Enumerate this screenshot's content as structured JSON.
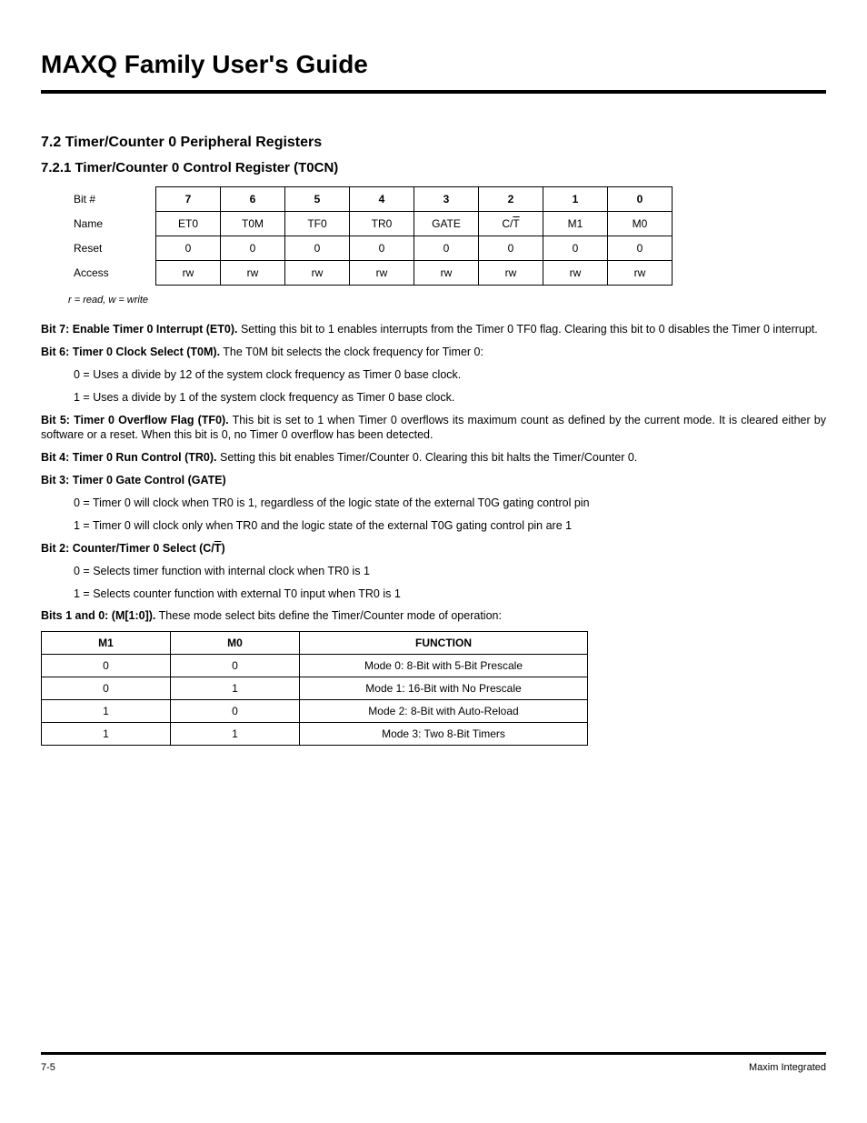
{
  "doc_title": "MAXQ Family User's Guide",
  "section": "7.2 Timer/Counter 0 Peripheral Registers",
  "subsection": "7.2.1 Timer/Counter 0 Control Register (T0CN)",
  "register_table": {
    "row_labels": [
      "Bit #",
      "Name",
      "Reset",
      "Access"
    ],
    "bit_nums": [
      "7",
      "6",
      "5",
      "4",
      "3",
      "2",
      "1",
      "0"
    ],
    "names": [
      "ET0",
      "T0M",
      "TF0",
      "TR0",
      "GATE",
      "C/",
      "M1",
      "M0"
    ],
    "t_overline": "T",
    "resets": [
      "0",
      "0",
      "0",
      "0",
      "0",
      "0",
      "0",
      "0"
    ],
    "access": [
      "rw",
      "rw",
      "rw",
      "rw",
      "rw",
      "rw",
      "rw",
      "rw"
    ]
  },
  "note": "r = read, w = write",
  "bit7": {
    "label": "Bit 7: Enable Timer 0 Interrupt (ET0).",
    "text": " Setting this bit to 1 enables interrupts from the Timer 0 TF0 flag. Clearing this bit to 0 disables the Timer 0 interrupt."
  },
  "bit6": {
    "label": "Bit 6: Timer 0 Clock Select (T0M).",
    "text": " The T0M bit selects the clock frequency for Timer 0:",
    "opt0": "0 = Uses a divide by 12 of the system clock frequency as Timer 0 base clock.",
    "opt1": "1 = Uses a divide by 1 of the system clock frequency as Timer 0 base clock."
  },
  "bit5": {
    "label": "Bit 5: Timer 0 Overflow Flag (TF0).",
    "text": " This bit is set to 1 when Timer 0 overflows its maximum count as defined by the current mode. It is cleared either by software or a reset. When this bit is 0, no Timer 0 overflow has been detected."
  },
  "bit4": {
    "label": "Bit 4: Timer 0 Run Control (TR0).",
    "text": " Setting this bit enables Timer/Counter 0. Clearing this bit halts the Timer/Counter 0."
  },
  "bit3": {
    "label": "Bit 3: Timer 0 Gate Control (GATE)",
    "opt0": "0 = Timer 0 will clock when TR0 is 1, regardless of the logic state of the external T0G gating control pin",
    "opt1": "1 = Timer 0 will clock only when TR0 and the logic state of the external T0G gating control pin are 1"
  },
  "bit2": {
    "label_a": "Bit 2: Counter/Timer 0 Select (C/",
    "label_t": "T",
    "label_b": ")",
    "opt0": "0 = Selects timer function with internal clock when TR0 is 1",
    "opt1": "1 = Selects counter function with external T0 input when TR0 is 1"
  },
  "bits10": {
    "label": "Bits 1 and 0: (M[1:0]).",
    "text": " These mode select bits define the Timer/Counter mode of operation:"
  },
  "mode_table": {
    "headers": [
      "M1",
      "M0",
      "FUNCTION"
    ],
    "rows": [
      [
        "0",
        "0",
        "Mode 0: 8-Bit with 5-Bit Prescale"
      ],
      [
        "0",
        "1",
        "Mode 1: 16-Bit with No Prescale"
      ],
      [
        "1",
        "0",
        "Mode 2: 8-Bit with Auto-Reload"
      ],
      [
        "1",
        "1",
        "Mode 3: Two 8-Bit Timers"
      ]
    ]
  },
  "footer": {
    "left": "7-5",
    "right": "Maxim Integrated"
  }
}
